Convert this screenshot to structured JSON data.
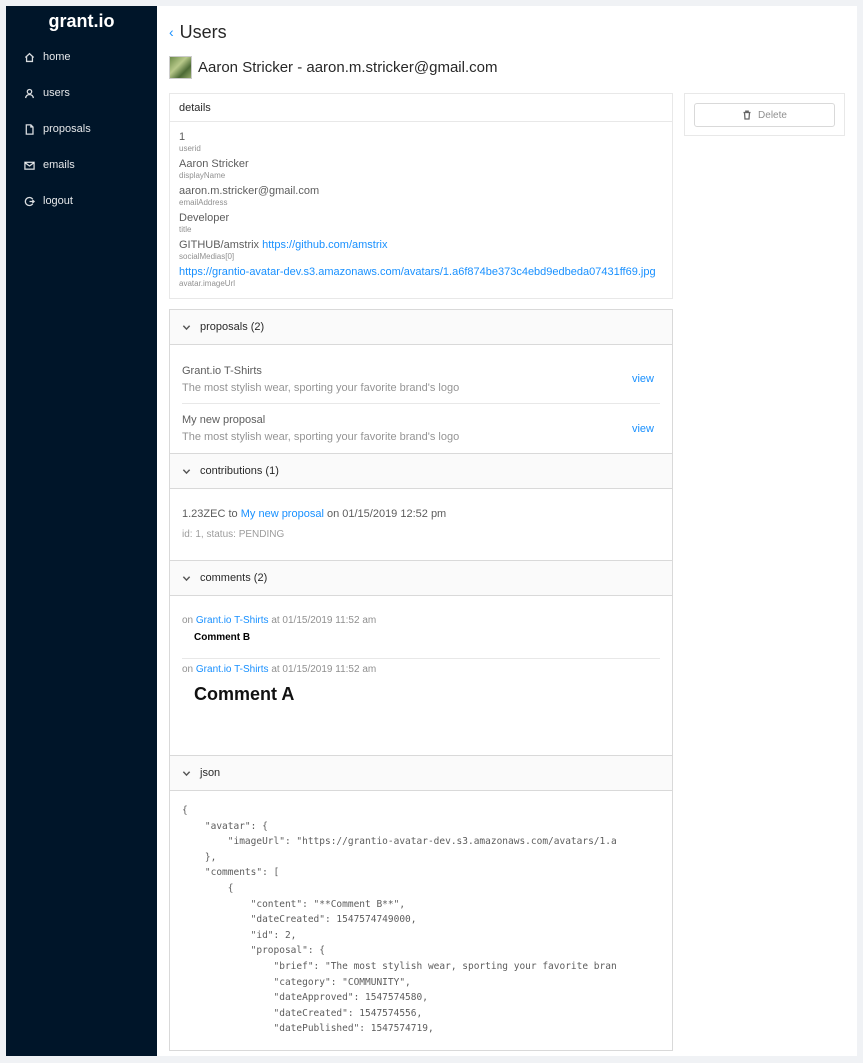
{
  "app": {
    "logo": "grant.io"
  },
  "nav": [
    {
      "label": "home",
      "icon": "home-icon"
    },
    {
      "label": "users",
      "icon": "user-icon"
    },
    {
      "label": "proposals",
      "icon": "file-icon"
    },
    {
      "label": "emails",
      "icon": "mail-icon"
    },
    {
      "label": "logout",
      "icon": "logout-icon"
    }
  ],
  "page": {
    "title": "Users",
    "back_icon": "arrow-left-icon"
  },
  "user": {
    "heading": "Aaron Stricker - aaron.m.stricker@gmail.com"
  },
  "details": {
    "header": "details",
    "fields": [
      {
        "value": "1",
        "key": "userid"
      },
      {
        "value": "Aaron Stricker",
        "key": "displayName"
      },
      {
        "value": "aaron.m.stricker@gmail.com",
        "key": "emailAddress"
      },
      {
        "value": "Developer",
        "key": "title"
      },
      {
        "value_prefix": "GITHUB/amstrix",
        "link": "https://github.com/amstrix",
        "key": "socialMedias[0]"
      },
      {
        "link": "https://grantio-avatar-dev.s3.amazonaws.com/avatars/1.a6f874be373c4ebd9edbeda07431ff69.jpg",
        "key": "avatar.imageUrl"
      }
    ]
  },
  "proposals": {
    "header": "proposals (2)",
    "items": [
      {
        "title": "Grant.io T-Shirts",
        "description": "The most stylish wear, sporting your favorite brand's logo",
        "action": "view"
      },
      {
        "title": "My new proposal",
        "description": "The most stylish wear, sporting your favorite brand's logo",
        "action": "view"
      }
    ]
  },
  "contributions": {
    "header": "contributions (1)",
    "amount": "1.23",
    "currency": "ZEC",
    "to": "to",
    "proposal": "My new proposal",
    "on": "on 01/15/2019 12:52 pm",
    "meta": "id: 1, status: PENDING"
  },
  "comments": {
    "header": "comments (2)",
    "items": [
      {
        "on": "on",
        "proposal": "Grant.io T-Shirts",
        "at": "at 01/15/2019 11:52 am",
        "content": "Comment B"
      },
      {
        "on": "on",
        "proposal": "Grant.io T-Shirts",
        "at": "at 01/15/2019 11:52 am",
        "content": "Comment A"
      }
    ]
  },
  "json": {
    "header": "json",
    "text": "{\n    \"avatar\": {\n        \"imageUrl\": \"https://grantio-avatar-dev.s3.amazonaws.com/avatars/1.a\n    },\n    \"comments\": [\n        {\n            \"content\": \"**Comment B**\",\n            \"dateCreated\": 1547574749000,\n            \"id\": 2,\n            \"proposal\": {\n                \"brief\": \"The most stylish wear, sporting your favorite bran\n                \"category\": \"COMMUNITY\",\n                \"dateApproved\": 1547574580,\n                \"dateCreated\": 1547574556,\n                \"datePublished\": 1547574719,"
  },
  "actions": {
    "delete_label": "Delete",
    "delete_icon": "trash-icon"
  }
}
